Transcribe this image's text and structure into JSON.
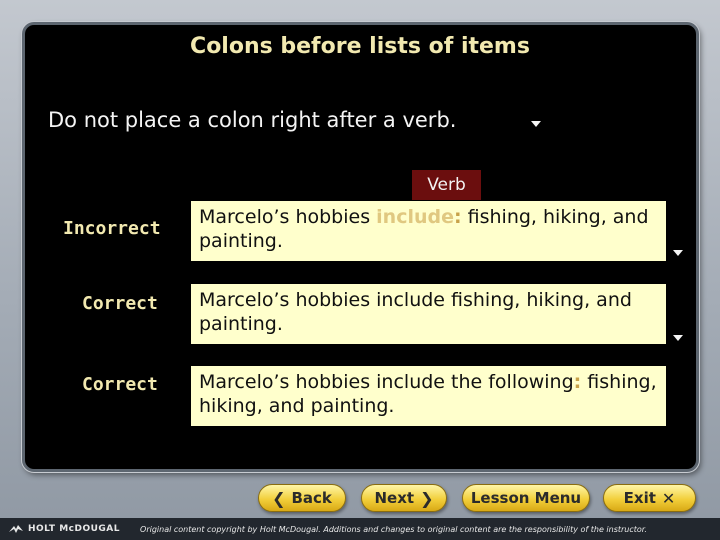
{
  "slide": {
    "title": "Colons before lists of items",
    "rule": "Do not place a colon right after a verb.",
    "verb_tag": "Verb"
  },
  "rows": [
    {
      "label": "Incorrect",
      "text_before": "Marcelo’s hobbies ",
      "text_highlight": "include",
      "text_colon": ":",
      "text_after": " fishing, hiking, and painting."
    },
    {
      "label": "Correct",
      "text": "Marcelo’s hobbies include fishing, hiking, and painting."
    },
    {
      "label": "Correct",
      "text_before": "Marcelo’s hobbies include the following",
      "text_colon": ":",
      "text_after": " fishing, hiking, and painting."
    }
  ],
  "nav": {
    "back": "Back",
    "next": "Next",
    "lesson_menu": "Lesson Menu",
    "exit": "Exit"
  },
  "footer": {
    "brand": "HOLT McDOUGAL",
    "notice": "Original content copyright by Holt McDougal. Additions and changes to original content are the responsibility of the instructor."
  },
  "icons": {
    "advance": "triangle-down-icon",
    "back": "chevron-left-icon",
    "next": "chevron-right-icon",
    "exit": "close-icon",
    "logo": "eagle-logo-icon"
  },
  "colors": {
    "panel": "#000000",
    "title": "#f2e9b0",
    "example_bg": "#ffffcc",
    "verb_tag_bg": "#6b0e0e",
    "button": "#f2cf3b"
  }
}
